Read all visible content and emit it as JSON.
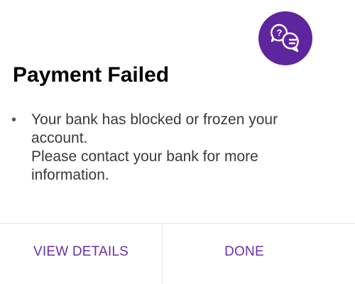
{
  "dialog": {
    "title": "Payment Failed",
    "message_lines": [
      "Your bank has blocked or frozen your account.",
      "Please contact your bank for more information."
    ],
    "bullet": "•"
  },
  "help_button": {
    "icon": "help-chat-icon",
    "glyph": "?"
  },
  "actions": {
    "view_details_label": "VIEW DETAILS",
    "done_label": "DONE"
  },
  "colors": {
    "accent": "#5f259f",
    "button_text": "#6a2fa6",
    "title": "#000000",
    "body_text": "#3a3a3a",
    "divider": "#e4e4e4",
    "background": "#ffffff"
  }
}
